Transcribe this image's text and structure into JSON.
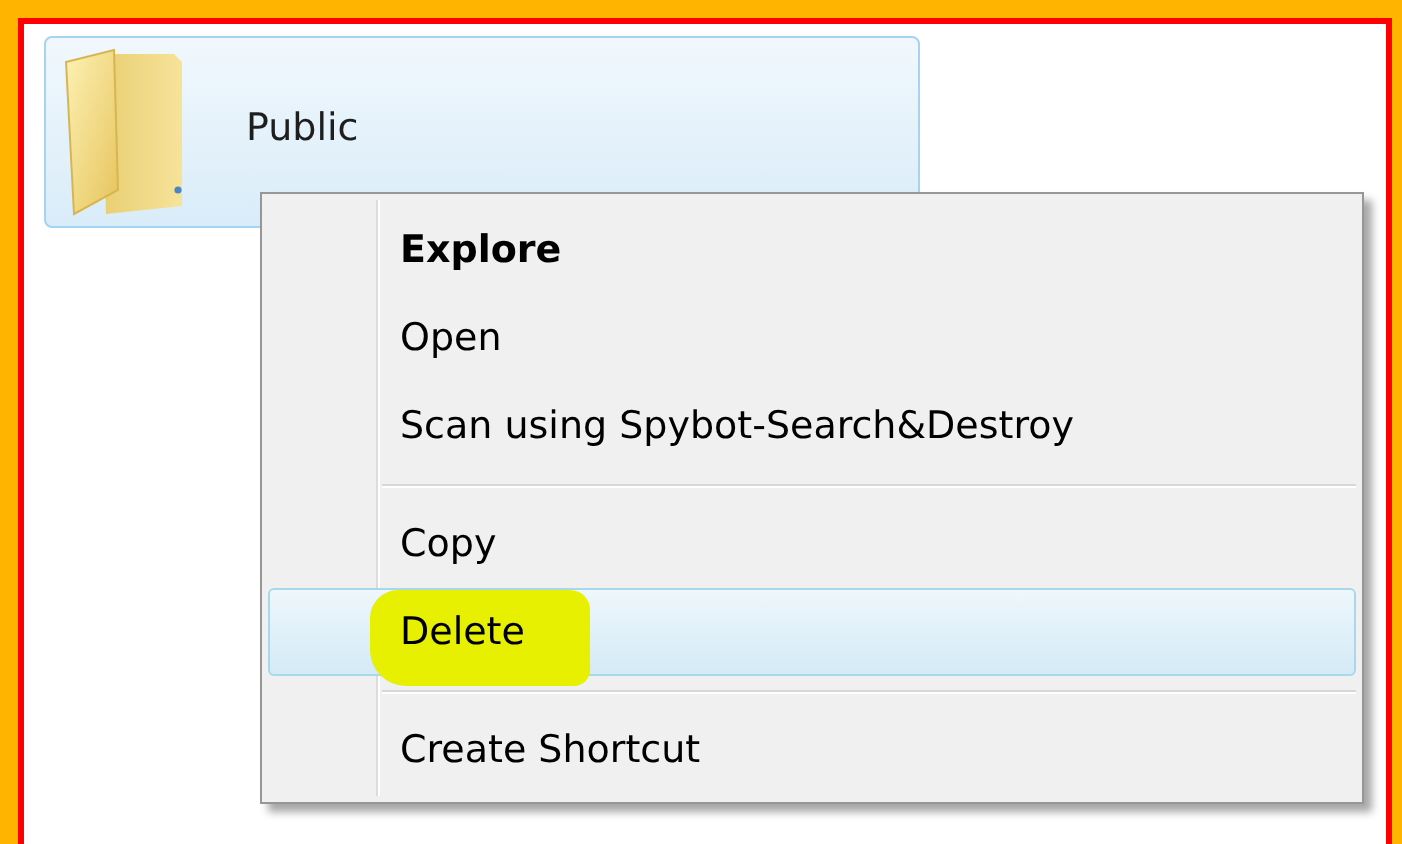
{
  "folder": {
    "name": "Public",
    "selected": true
  },
  "context_menu": {
    "items": [
      {
        "kind": "item",
        "label": "Explore",
        "default": true,
        "selected": false,
        "highlighted": false
      },
      {
        "kind": "item",
        "label": "Open",
        "default": false,
        "selected": false,
        "highlighted": false
      },
      {
        "kind": "item",
        "label": "Scan using Spybot-Search&Destroy",
        "default": false,
        "selected": false,
        "highlighted": false
      },
      {
        "kind": "separator"
      },
      {
        "kind": "item",
        "label": "Copy",
        "default": false,
        "selected": false,
        "highlighted": false
      },
      {
        "kind": "item",
        "label": "Delete",
        "default": false,
        "selected": true,
        "highlighted": true
      },
      {
        "kind": "separator"
      },
      {
        "kind": "item",
        "label": "Create Shortcut",
        "default": false,
        "selected": false,
        "highlighted": false
      }
    ]
  }
}
